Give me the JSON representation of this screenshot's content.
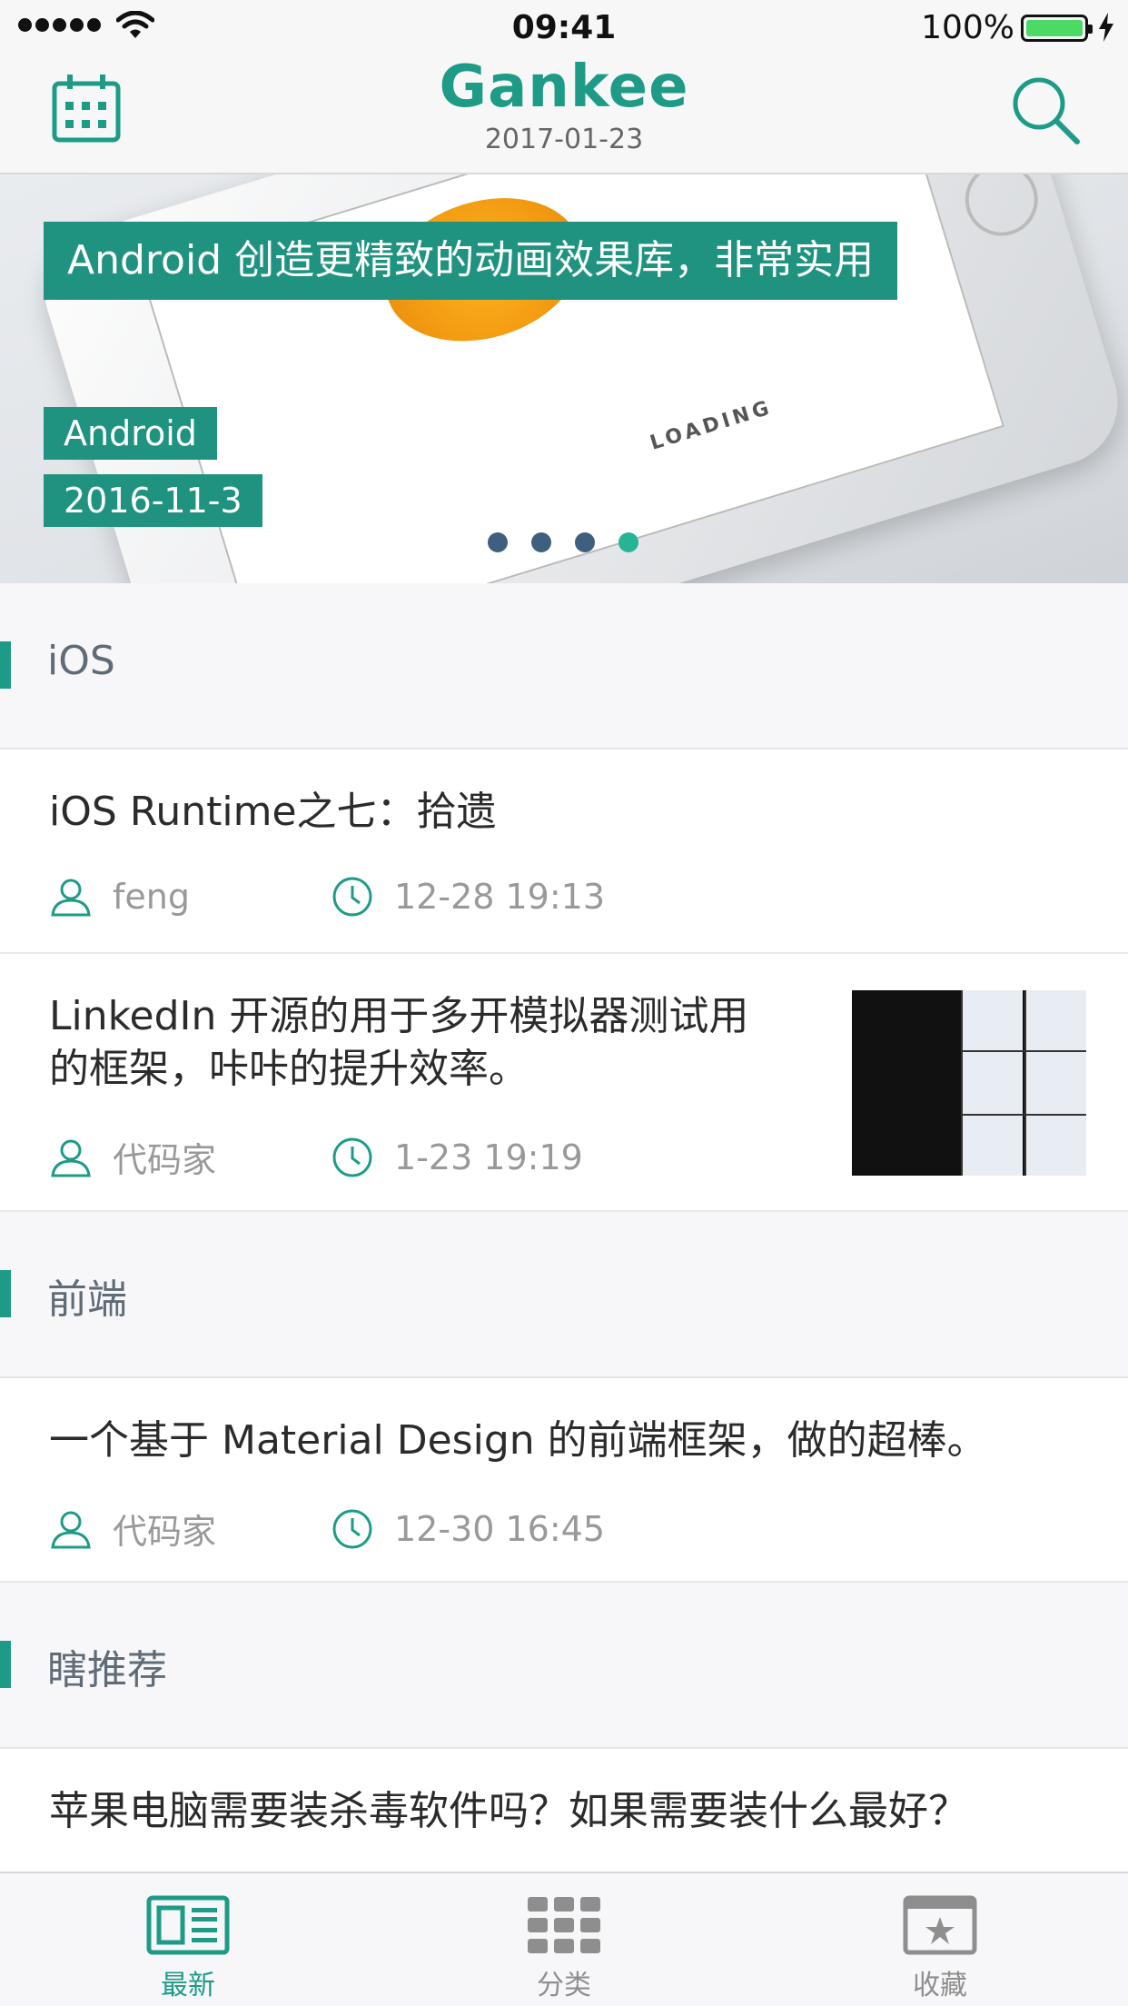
{
  "status_bar": {
    "time": "09:41",
    "battery": "100%"
  },
  "nav": {
    "brand": "Gankee",
    "date": "2017-01-23"
  },
  "banner": {
    "title": "Android 创造更精致的动画效果库，非常实用",
    "tag": "Android",
    "date": "2016-11-3",
    "phone_text": "LOADING",
    "page_count": 4,
    "active_page": 4
  },
  "sections": [
    {
      "label": "iOS",
      "items": [
        {
          "title": "iOS Runtime之七：拾遗",
          "author": "feng",
          "time": "12-28  19:13"
        },
        {
          "title": "LinkedIn 开源的用于多开模拟器测试用的框架，咔咔的提升效率。",
          "title_line1": "LinkedIn 开源的用于多开模拟器测试用",
          "title_line2": "的框架，咔咔的提升效率。",
          "author": "代码家",
          "time": "1-23  19:19",
          "has_thumbnail": true
        }
      ]
    },
    {
      "label": "前端",
      "items": [
        {
          "title": "一个基于 Material Design 的前端框架，做的超棒。",
          "author": "代码家",
          "time": "12-30  16:45"
        }
      ]
    },
    {
      "label": "瞎推荐",
      "items": [
        {
          "title": "苹果电脑需要装杀毒软件吗？如果需要装什么最好？"
        }
      ]
    }
  ],
  "tabbar": {
    "tabs": [
      {
        "label": "最新",
        "icon": "newspaper-icon",
        "active": true
      },
      {
        "label": "分类",
        "icon": "grid-icon",
        "active": false
      },
      {
        "label": "收藏",
        "icon": "star-box-icon",
        "active": false
      }
    ]
  },
  "colors": {
    "accent": "#1e9b86",
    "banner_label_bg": "#1f937f",
    "inactive": "#8e8e8e"
  }
}
